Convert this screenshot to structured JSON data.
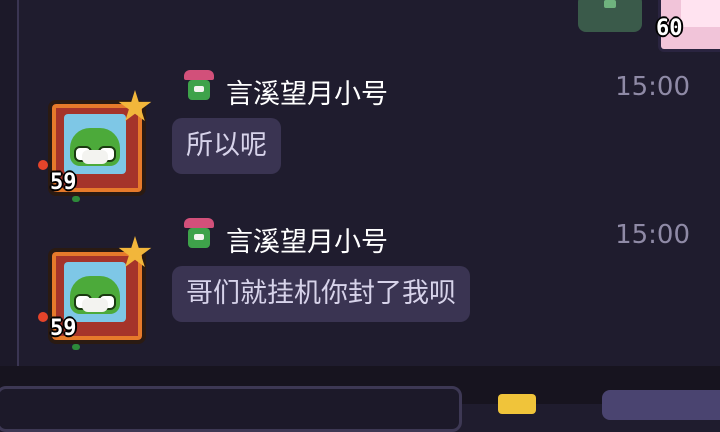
{
  "header": {
    "partner_level": "60"
  },
  "messages": [
    {
      "sender": "言溪望月小号",
      "time": "15:00",
      "text": "所以呢",
      "level": "59"
    },
    {
      "sender": "言溪望月小号",
      "time": "15:00",
      "text": "哥们就挂机你封了我呗",
      "level": "59"
    }
  ],
  "colors": {
    "background": "#1f1c2e",
    "bubble": "#3a3452",
    "text": "#d7d3ea",
    "timestamp": "#8f8aa6"
  },
  "icons": {
    "avatar": "frog-avatar-icon",
    "badge": "flower-pot-badge-icon",
    "star": "star-icon"
  }
}
